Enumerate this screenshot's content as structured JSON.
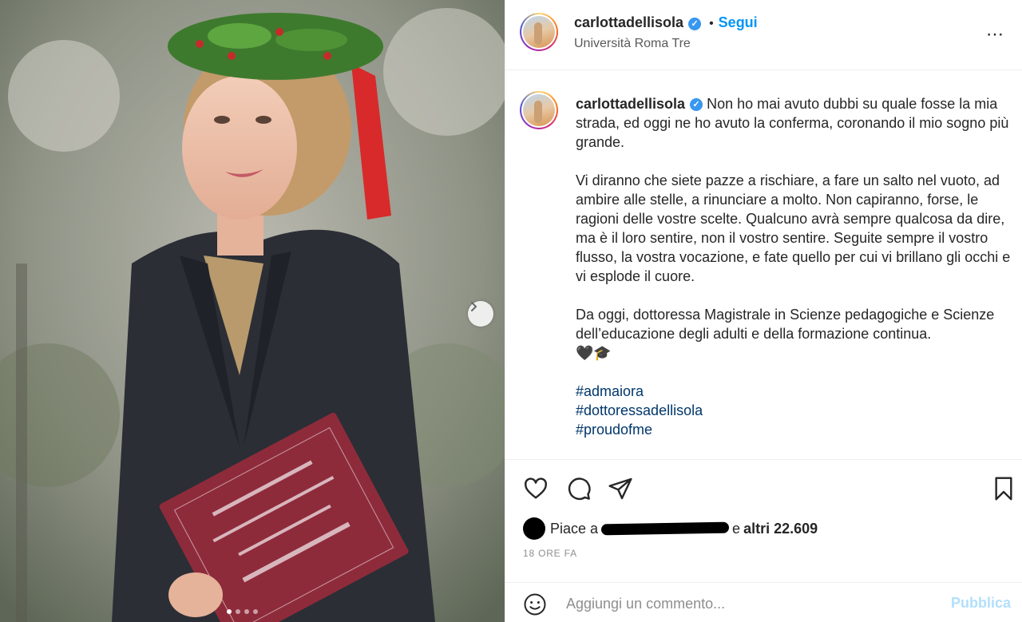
{
  "header": {
    "username": "carlottadellisola",
    "verified_mark": "✓",
    "separator": "•",
    "follow_label": "Segui",
    "location": "Università Roma Tre",
    "more_icon": "⋯"
  },
  "caption": {
    "username": "carlottadellisola",
    "verified_mark": "✓",
    "paragraph_1": "Non ho mai avuto dubbi su quale fosse la mia strada, ed oggi ne ho avuto la conferma, coronando il mio sogno più grande.",
    "paragraph_2": "Vi diranno che siete pazze a rischiare, a fare un salto nel vuoto, ad ambire alle stelle, a rinunciare a molto. Non capiranno, forse, le ragioni delle vostre scelte. Qualcuno avrà sempre qualcosa da dire, ma è il loro sentire, non il vostro sentire. Seguite sempre il vostro flusso, la vostra vocazione, e fate quello per cui vi brillano gli occhi e vi esplode il cuore.",
    "paragraph_3": "Da oggi, dottoressa Magistrale in Scienze pedagogiche e Scienze dell’educazione degli adulti e della formazione continua.",
    "emojis": "🖤🎓",
    "hashtags": [
      "#admaiora",
      "#dottoressadellisola",
      "#proudofme"
    ]
  },
  "likes": {
    "prefix": "Piace a",
    "suffix": "e",
    "others": "altri 22.609"
  },
  "timestamp": "18 ORE FA",
  "comment": {
    "placeholder": "Aggiungi un commento...",
    "publish_label": "Pubblica"
  },
  "carousel": {
    "slide_count": 4,
    "current_slide": 1
  },
  "colors": {
    "follow": "#0095f6",
    "hashtag": "#00376b",
    "publish_disabled": "#b2dffc",
    "verified": "#3897f0"
  }
}
